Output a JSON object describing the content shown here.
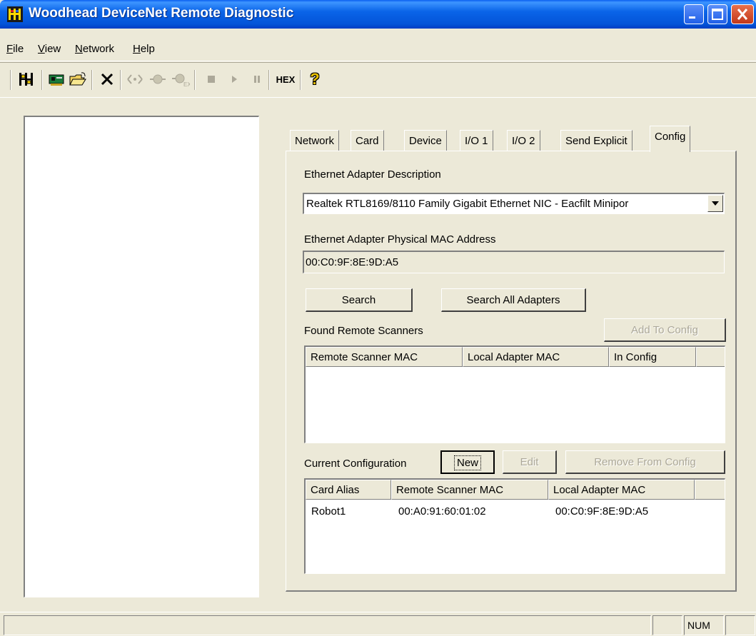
{
  "window": {
    "title": "Woodhead DeviceNet Remote Diagnostic",
    "controls": [
      "minimize",
      "maximize",
      "close"
    ]
  },
  "menu": [
    {
      "label": "File",
      "mnemonic": "F",
      "rest": "ile"
    },
    {
      "label": "View",
      "mnemonic": "V",
      "rest": "iew"
    },
    {
      "label": "Network",
      "mnemonic": "N",
      "rest": "etwork"
    },
    {
      "label": "Help",
      "mnemonic": "H",
      "rest": "elp"
    }
  ],
  "toolbar": {
    "icons": [
      "network-scan-icon",
      "card-icon",
      "open-folder-icon",
      "delete-icon",
      "online-icon",
      "device-icon",
      "device-explicit-icon",
      "stop-icon",
      "play-icon",
      "pause-icon",
      "hex-icon",
      "help-icon"
    ],
    "hex_label": "HEX",
    "help_label": "?"
  },
  "tabs": [
    {
      "label": "Network",
      "active": false
    },
    {
      "label": "Card",
      "active": false
    },
    {
      "label": "Device",
      "active": false
    },
    {
      "label": "I/O 1",
      "active": false
    },
    {
      "label": "I/O 2",
      "active": false
    },
    {
      "label": "Send Explicit",
      "active": false
    },
    {
      "label": "Config",
      "active": true
    }
  ],
  "config": {
    "adapter_desc_label": "Ethernet Adapter Description",
    "adapter_desc_value": "Realtek RTL8169/8110 Family Gigabit Ethernet NIC - Eacfilt Minipor",
    "mac_label": "Ethernet Adapter Physical MAC Address",
    "mac_value": "00:C0:9F:8E:9D:A5",
    "search_button": "Search",
    "search_all_button": "Search All Adapters",
    "found_label": "Found Remote Scanners",
    "add_to_config_button": "Add To Config",
    "found_columns": [
      "Remote Scanner MAC",
      "Local Adapter MAC",
      "In Config"
    ],
    "found_rows": [],
    "current_label": "Current Configuration",
    "new_button": "New",
    "edit_button": "Edit",
    "remove_button": "Remove From Config",
    "current_columns": [
      "Card Alias",
      "Remote Scanner MAC",
      "Local Adapter MAC"
    ],
    "current_rows": [
      {
        "alias": "Robot1",
        "remote_mac": "00:A0:91:60:01:02",
        "local_mac": "00:C0:9F:8E:9D:A5"
      }
    ]
  },
  "status": {
    "num": "NUM"
  },
  "colors": {
    "titlebar": "#0a5ff0",
    "face": "#ece9d8",
    "disabled_text": "#aca899"
  }
}
